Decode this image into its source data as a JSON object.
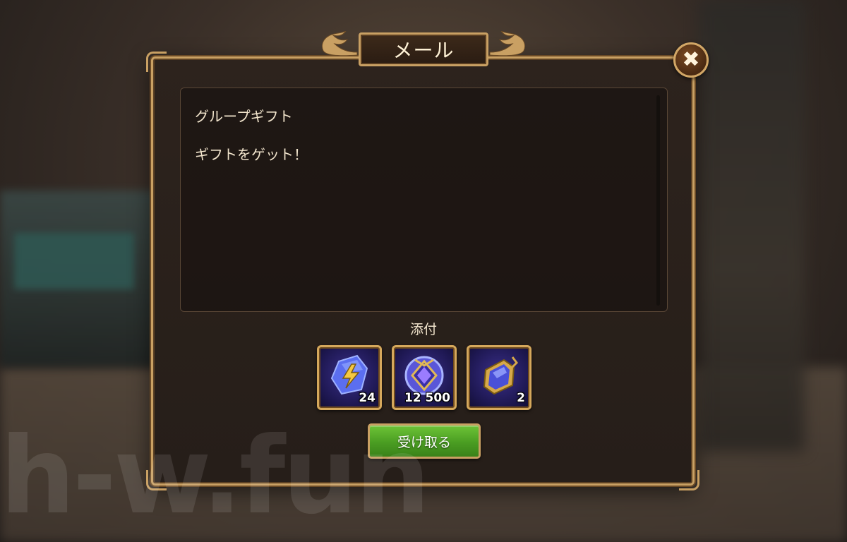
{
  "dialog": {
    "title": "メール",
    "close_icon": "✖"
  },
  "message": {
    "subject": "グループギフト",
    "body": "ギフトをゲット！"
  },
  "attachments": {
    "label": "添付",
    "items": [
      {
        "icon": "lightning-crystal-icon",
        "count": "24"
      },
      {
        "icon": "blue-emblem-icon",
        "count": "12 500"
      },
      {
        "icon": "blue-gem-artifact-icon",
        "count": "2"
      }
    ]
  },
  "actions": {
    "claim_label": "受け取る"
  },
  "watermark": "h-w.fun",
  "colors": {
    "frame_gold": "#c9a063",
    "panel_bg": "#2d231d",
    "claim_green": "#4a9d22"
  }
}
